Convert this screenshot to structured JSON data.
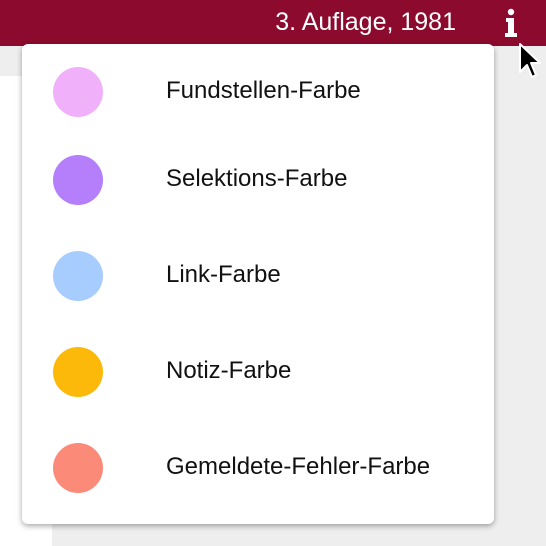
{
  "header": {
    "edition_text": "3. Auflage, 1981",
    "info_icon": "info-icon",
    "bar_color": "#8b0a2e"
  },
  "menu": {
    "items": [
      {
        "label": "Fundstellen-Farbe",
        "color": "#f0b0fa"
      },
      {
        "label": "Selektions-Farbe",
        "color": "#b57ffb"
      },
      {
        "label": "Link-Farbe",
        "color": "#a6cdfd"
      },
      {
        "label": "Notiz-Farbe",
        "color": "#fdb90a"
      },
      {
        "label": "Gemeldete-Fehler-Farbe",
        "color": "#fb8a78"
      }
    ]
  }
}
